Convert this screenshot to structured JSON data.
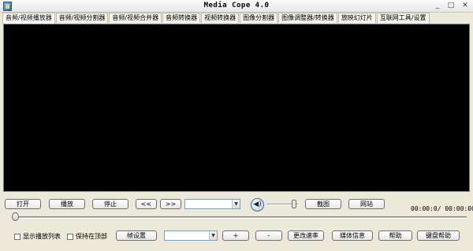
{
  "window": {
    "title": "Media Cope 4.0",
    "controls": {
      "minimize": "_",
      "maximize": "□",
      "close": "✕"
    }
  },
  "tabs": [
    {
      "label": "音频/视频播放器",
      "active": true
    },
    {
      "label": "音频/视频分割器",
      "active": false
    },
    {
      "label": "音频/视频合并器",
      "active": false
    },
    {
      "label": "音频转换器",
      "active": false
    },
    {
      "label": "视频转换器",
      "active": false
    },
    {
      "label": "图像分割器",
      "active": false
    },
    {
      "label": "图像调整器/转换器",
      "active": false
    },
    {
      "label": "放映幻灯片",
      "active": false
    },
    {
      "label": "互联网工具/设置",
      "active": false
    }
  ],
  "controls": {
    "open": "打开",
    "play": "播放",
    "stop": "停止",
    "rewind": "<<",
    "forward": ">>",
    "screenshot": "截图",
    "website": "网站",
    "volume_icon": "speaker-icon",
    "time": "00:00:0/ 00:00:00"
  },
  "bottom": {
    "show_playlist": "显示播放列表",
    "keep_on_top": "保持在顶部",
    "frame_settings": "帧设置",
    "plus": "+",
    "minus": "-",
    "change_rate": "更改速率",
    "media_info": "媒体信息",
    "help": "帮助",
    "keyboard_help": "键盘帮助"
  },
  "colors": {
    "chrome": "#ece9d8",
    "video_bg": "#000000",
    "accent": "#3a6ea5"
  }
}
